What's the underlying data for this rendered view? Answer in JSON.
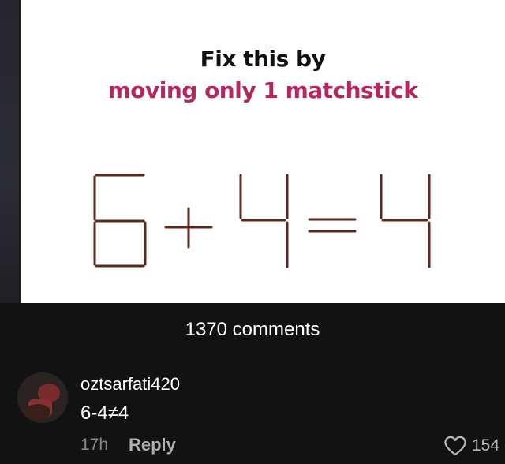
{
  "puzzle": {
    "title": "Fix this by",
    "subtitle": "moving only 1 matchstick",
    "equation_text": "6+4=4",
    "colors": {
      "title": "#111111",
      "subtitle": "#b3265e",
      "matchstick": "#5a2a1e"
    }
  },
  "comments": {
    "count_label": "1370 comments",
    "items": [
      {
        "username": "oztsarfati420",
        "text": "6-4≠4",
        "time": "17h",
        "reply_label": "Reply",
        "likes": "154",
        "avatar_icon": "user-avatar"
      }
    ]
  },
  "icons": {
    "like": "heart-outline-icon"
  }
}
